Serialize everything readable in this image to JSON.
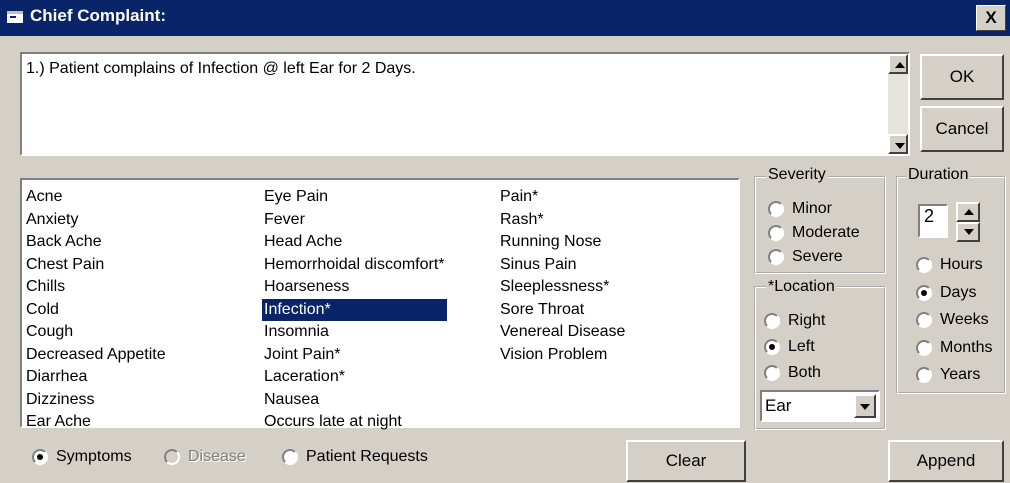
{
  "window": {
    "title": "Chief Complaint:",
    "close_label": "X"
  },
  "complaint": {
    "text": "1.) Patient complains of Infection @ left Ear for 2 Days."
  },
  "buttons": {
    "ok": "OK",
    "cancel": "Cancel",
    "clear": "Clear",
    "append": "Append"
  },
  "list": {
    "col1": [
      "Acne",
      "Anxiety",
      "Back Ache",
      "Chest Pain",
      "Chills",
      "Cold",
      "Cough",
      "Decreased Appetite",
      "Diarrhea",
      "Dizziness",
      "Ear Ache"
    ],
    "col2": [
      "Eye Pain",
      "Fever",
      "Head Ache",
      "Hemorrhoidal discomfort*",
      "Hoarseness",
      "Infection*",
      "Insomnia",
      "Joint Pain*",
      "Laceration*",
      "Nausea",
      "Occurs late at night"
    ],
    "col3": [
      "Pain*",
      "Rash*",
      "Running Nose",
      "Sinus Pain",
      "Sleeplessness*",
      "Sore Throat",
      "Venereal Disease",
      "Vision Problem"
    ],
    "selected": "Infection*"
  },
  "list_type": {
    "options": [
      {
        "label": "Symptoms",
        "checked": true,
        "disabled": false
      },
      {
        "label": "Disease",
        "checked": false,
        "disabled": true
      },
      {
        "label": "Patient Requests",
        "checked": false,
        "disabled": false
      }
    ]
  },
  "severity": {
    "legend": "Severity",
    "options": [
      "Minor",
      "Moderate",
      "Severe"
    ],
    "selected": null
  },
  "location": {
    "legend": "*Location",
    "options": [
      "Right",
      "Left",
      "Both"
    ],
    "selected": "Left",
    "site": "Ear"
  },
  "duration": {
    "legend": "Duration",
    "value": "2",
    "options": [
      "Hours",
      "Days",
      "Weeks",
      "Months",
      "Years"
    ],
    "selected": "Days"
  },
  "colors": {
    "titlebar": "#0a246a",
    "face": "#d4d0c8",
    "selection": "#0a246a"
  }
}
